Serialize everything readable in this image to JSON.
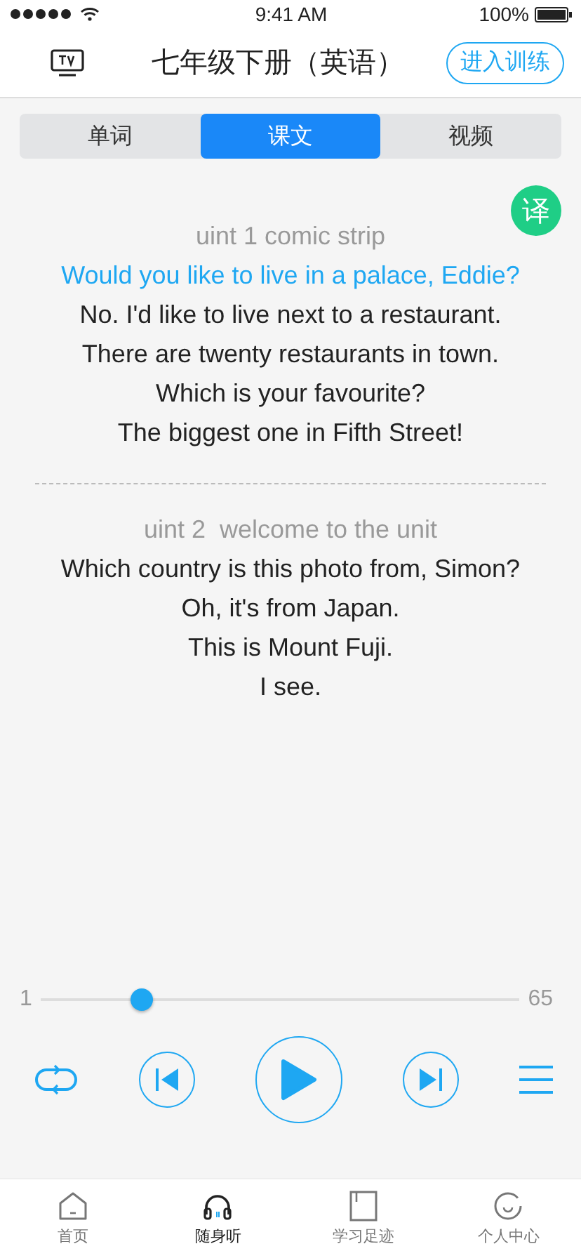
{
  "status_bar": {
    "time": "9:41 AM",
    "battery": "100%"
  },
  "header": {
    "title": "七年级下册（英语）",
    "action": "进入训练"
  },
  "tabs": [
    {
      "label": "单词",
      "selected": false
    },
    {
      "label": "课文",
      "selected": true
    },
    {
      "label": "视频",
      "selected": false
    }
  ],
  "translate_button": "译",
  "sections": [
    {
      "title": "uint 1 comic strip",
      "lines": [
        {
          "text": "Would you like to live in a palace, Eddie?",
          "playing": true
        },
        {
          "text": "No. I'd like to live next to a restaurant.",
          "playing": false
        },
        {
          "text": "There are twenty restaurants in town.",
          "playing": false
        },
        {
          "text": "Which is your favourite?",
          "playing": false
        },
        {
          "text": "The biggest one in Fifth Street!",
          "playing": false
        }
      ]
    },
    {
      "title": "uint 2  welcome to the unit",
      "lines": [
        {
          "text": "Which country is this photo from, Simon?",
          "playing": false
        },
        {
          "text": "Oh, it's from Japan.",
          "playing": false
        },
        {
          "text": "This is Mount Fuji.",
          "playing": false
        },
        {
          "text": "I see.",
          "playing": false
        }
      ]
    }
  ],
  "progress": {
    "start": "1",
    "end": "65",
    "level": 0.21
  },
  "nav": [
    {
      "label": "首页",
      "kind": "home",
      "selected": false
    },
    {
      "label": "随身听",
      "kind": "listen",
      "selected": true
    },
    {
      "label": "学习足迹",
      "kind": "book",
      "selected": false
    },
    {
      "label": "个人中心",
      "kind": "profile",
      "selected": false
    }
  ]
}
